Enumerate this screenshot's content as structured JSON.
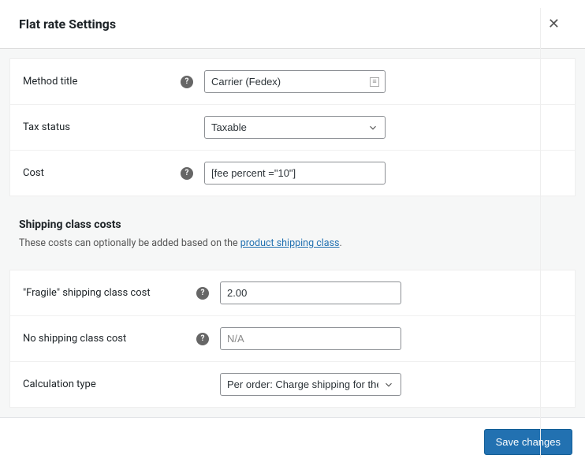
{
  "modal": {
    "title": "Flat rate Settings",
    "save_label": "Save changes"
  },
  "fields": {
    "method_title": {
      "label": "Method title",
      "value": "Carrier (Fedex)"
    },
    "tax_status": {
      "label": "Tax status",
      "value": "Taxable"
    },
    "cost": {
      "label": "Cost",
      "value": "[fee percent =\"10\"]"
    }
  },
  "shipping_class": {
    "heading": "Shipping class costs",
    "desc_prefix": "These costs can optionally be added based on the ",
    "desc_link": "product shipping class",
    "desc_suffix": ".",
    "fragile": {
      "label": "\"Fragile\" shipping class cost",
      "value": "2.00"
    },
    "no_class": {
      "label": "No shipping class cost",
      "placeholder": "N/A"
    },
    "calc_type": {
      "label": "Calculation type",
      "value": "Per order: Charge shipping for the most expensive shipping class"
    }
  }
}
